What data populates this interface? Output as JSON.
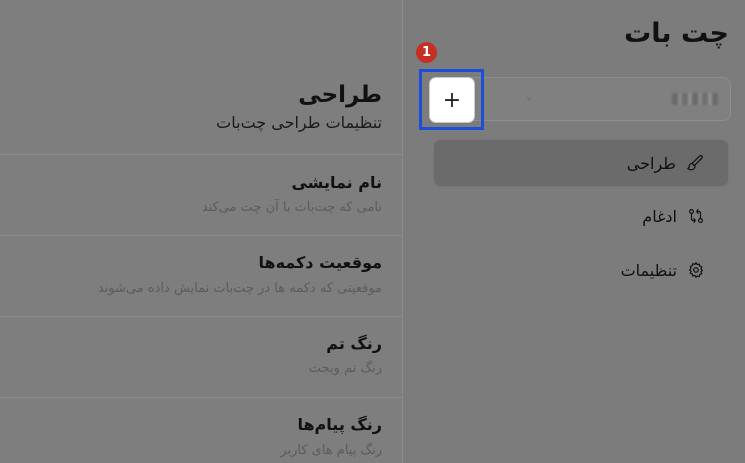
{
  "app": {
    "title": "چت بات"
  },
  "bot_selector": {
    "chevron": "⌄"
  },
  "add_button": {
    "label": "+",
    "step_badge": "1"
  },
  "sidebar": {
    "items": [
      {
        "label": "طراحی",
        "icon": "brush-icon",
        "active": true
      },
      {
        "label": "ادغام",
        "icon": "git-compare-icon",
        "active": false
      },
      {
        "label": "تنظیمات",
        "icon": "gear-icon",
        "active": false
      }
    ]
  },
  "main": {
    "title": "طراحی",
    "subtitle": "تنظیمات طراحی چت‌بات",
    "settings": [
      {
        "title": "نام نمایشی",
        "description": "نامی که چت‌بات با آن چت می‌کند"
      },
      {
        "title": "موقعیت دکمه‌ها",
        "description": "موقعیتی که دکمه ها در چت‌بات نمایش داده می‌شوند"
      },
      {
        "title": "رنگ تم",
        "description": "رنگ تم ویجت"
      },
      {
        "title": "رنگ پیام‌ها",
        "description": "رنگ پیام های کاربر"
      }
    ]
  },
  "colors": {
    "highlight": "#1d4ed8",
    "badge": "#c63024"
  }
}
